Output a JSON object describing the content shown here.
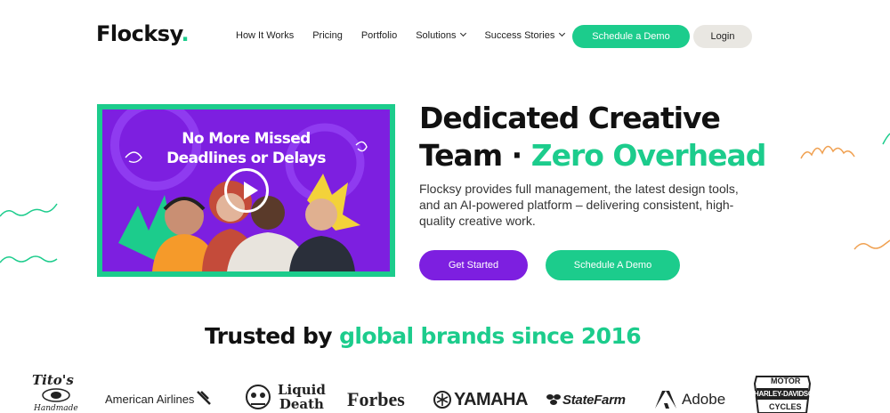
{
  "brand": {
    "name": "Flocksy",
    "dot": "."
  },
  "nav": {
    "links": [
      {
        "label": "How It Works",
        "dropdown": false
      },
      {
        "label": "Pricing",
        "dropdown": false
      },
      {
        "label": "Portfolio",
        "dropdown": false
      },
      {
        "label": "Solutions",
        "dropdown": true
      },
      {
        "label": "Success Stories",
        "dropdown": true
      }
    ],
    "schedule_label": "Schedule a Demo",
    "login_label": "Login"
  },
  "video": {
    "title_line1": "No More Missed",
    "title_line2": "Deadlines or Delays",
    "play_icon": "play-icon"
  },
  "hero": {
    "title_line1": "Dedicated Creative",
    "title_line2_plain": "Team · ",
    "title_line2_accent": "Zero Overhead",
    "description": "Flocksy provides full management, the latest design tools, and an AI-powered platform – delivering consistent, high-quality creative work.",
    "cta_primary": "Get Started",
    "cta_secondary": "Schedule A Demo"
  },
  "trusted": {
    "plain": "Trusted by ",
    "accent": "global brands since 2016"
  },
  "logos": {
    "titos": "Tito's",
    "titos_sub": "Handmade",
    "american": "American Airlines",
    "liquid_line1": "Liquid",
    "liquid_line2": "Death",
    "forbes": "Forbes",
    "yamaha": "YAMAHA",
    "statefarm": "StateFarm",
    "adobe": "Adobe",
    "hd_line1": "MOTOR",
    "hd_line2": "HARLEY-DAVIDSON",
    "hd_line3": "CYCLES"
  },
  "colors": {
    "accent_green": "#1ccc8c",
    "accent_purple": "#7d1fe0",
    "login_bg": "#e9e7e2",
    "squiggle_orange": "#f0a050"
  }
}
